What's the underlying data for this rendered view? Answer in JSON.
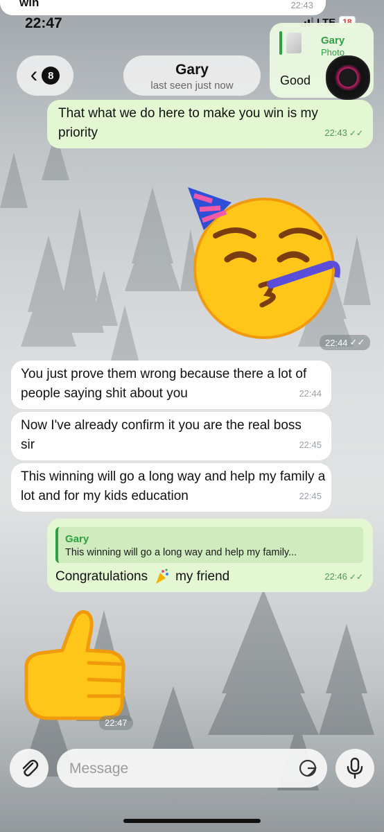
{
  "status_bar": {
    "time": "22:47",
    "network": "LTE",
    "battery": "18"
  },
  "prev_message": {
    "text": "win",
    "time": "22:43"
  },
  "header": {
    "unread_count": "8",
    "contact_name": "Gary",
    "last_seen": "last seen just now"
  },
  "pip_preview": {
    "quote_name": "Gary",
    "quote_text": "Photo",
    "text": "Good"
  },
  "messages": [
    {
      "direction": "out",
      "text": "That what we do here to make you win is my priority",
      "time": "22:43",
      "read": true
    },
    {
      "direction": "out",
      "type": "sticker",
      "icon": "party-face-emoji",
      "time": "22:44",
      "read": true
    },
    {
      "direction": "in",
      "text": "You just prove them wrong because there a lot of people saying shit about you",
      "time": "22:44"
    },
    {
      "direction": "in",
      "text": "Now I've already confirm it you are the real boss sir",
      "time": "22:45"
    },
    {
      "direction": "in",
      "text": "This winning will go a long way and help my family a lot and for my kids education",
      "time": "22:45"
    },
    {
      "direction": "out",
      "reply_to": {
        "name": "Gary",
        "text": "This winning will go a long way and help my family..."
      },
      "text_before": "Congratulations",
      "emoji": "party-popper",
      "text_after": "my friend",
      "time": "22:46",
      "read": true
    },
    {
      "direction": "in",
      "type": "sticker",
      "icon": "thumbs-up-emoji",
      "time": "22:47"
    }
  ],
  "composer": {
    "placeholder": "Message"
  },
  "colors": {
    "outgoing_bubble": "#e3f7d2",
    "incoming_bubble": "#ffffff",
    "accent": "#2ea043"
  }
}
